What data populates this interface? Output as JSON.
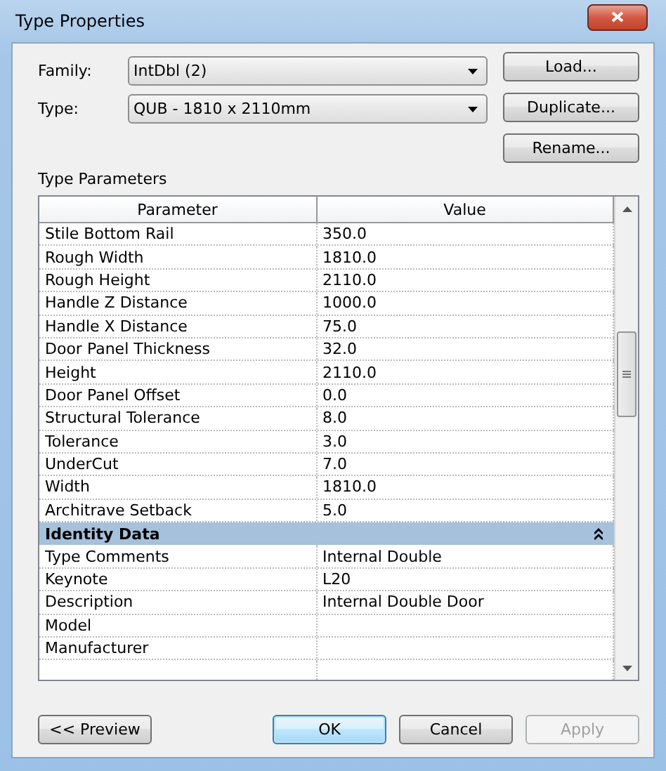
{
  "window": {
    "title": "Type Properties"
  },
  "fields": [
    {
      "label": "Family:",
      "value": "IntDbl (2)"
    },
    {
      "label": "Type:",
      "value": "QUB - 1810 x 2110mm"
    }
  ],
  "side_buttons": [
    "Load...",
    "Duplicate...",
    "Rename..."
  ],
  "section_label": "Type Parameters",
  "table": {
    "columns": [
      "Parameter",
      "Value"
    ],
    "rows": [
      {
        "kind": "param",
        "name": "Stile Bottom Rail",
        "value": "350.0"
      },
      {
        "kind": "param",
        "name": "Rough Width",
        "value": "1810.0"
      },
      {
        "kind": "param",
        "name": "Rough Height",
        "value": "2110.0"
      },
      {
        "kind": "param",
        "name": "Handle Z Distance",
        "value": "1000.0"
      },
      {
        "kind": "param",
        "name": "Handle X Distance",
        "value": "75.0"
      },
      {
        "kind": "param",
        "name": "Door Panel Thickness",
        "value": "32.0"
      },
      {
        "kind": "param",
        "name": "Height",
        "value": "2110.0"
      },
      {
        "kind": "param",
        "name": "Door Panel Offset",
        "value": "0.0"
      },
      {
        "kind": "param",
        "name": "Structural Tolerance",
        "value": "8.0"
      },
      {
        "kind": "param",
        "name": "Tolerance",
        "value": "3.0"
      },
      {
        "kind": "param",
        "name": "UnderCut",
        "value": "7.0"
      },
      {
        "kind": "param",
        "name": "Width",
        "value": "1810.0"
      },
      {
        "kind": "param",
        "name": "Architrave Setback",
        "value": "5.0"
      },
      {
        "kind": "group",
        "name": "Identity Data",
        "expanded": true
      },
      {
        "kind": "param",
        "name": "Type Comments",
        "value": "Internal Double"
      },
      {
        "kind": "param",
        "name": "Keynote",
        "value": "L20"
      },
      {
        "kind": "param",
        "name": "Description",
        "value": "Internal Double Door"
      },
      {
        "kind": "param",
        "name": "Model"
      },
      {
        "kind": "param",
        "name": "Manufacturer"
      }
    ]
  },
  "bottom_buttons": [
    {
      "label": "<< Preview",
      "disabled": false,
      "default": false
    },
    {
      "label": "OK",
      "disabled": false,
      "default": true
    },
    {
      "label": "Cancel",
      "disabled": false,
      "default": false
    },
    {
      "label": "Apply",
      "disabled": true,
      "default": false
    }
  ]
}
